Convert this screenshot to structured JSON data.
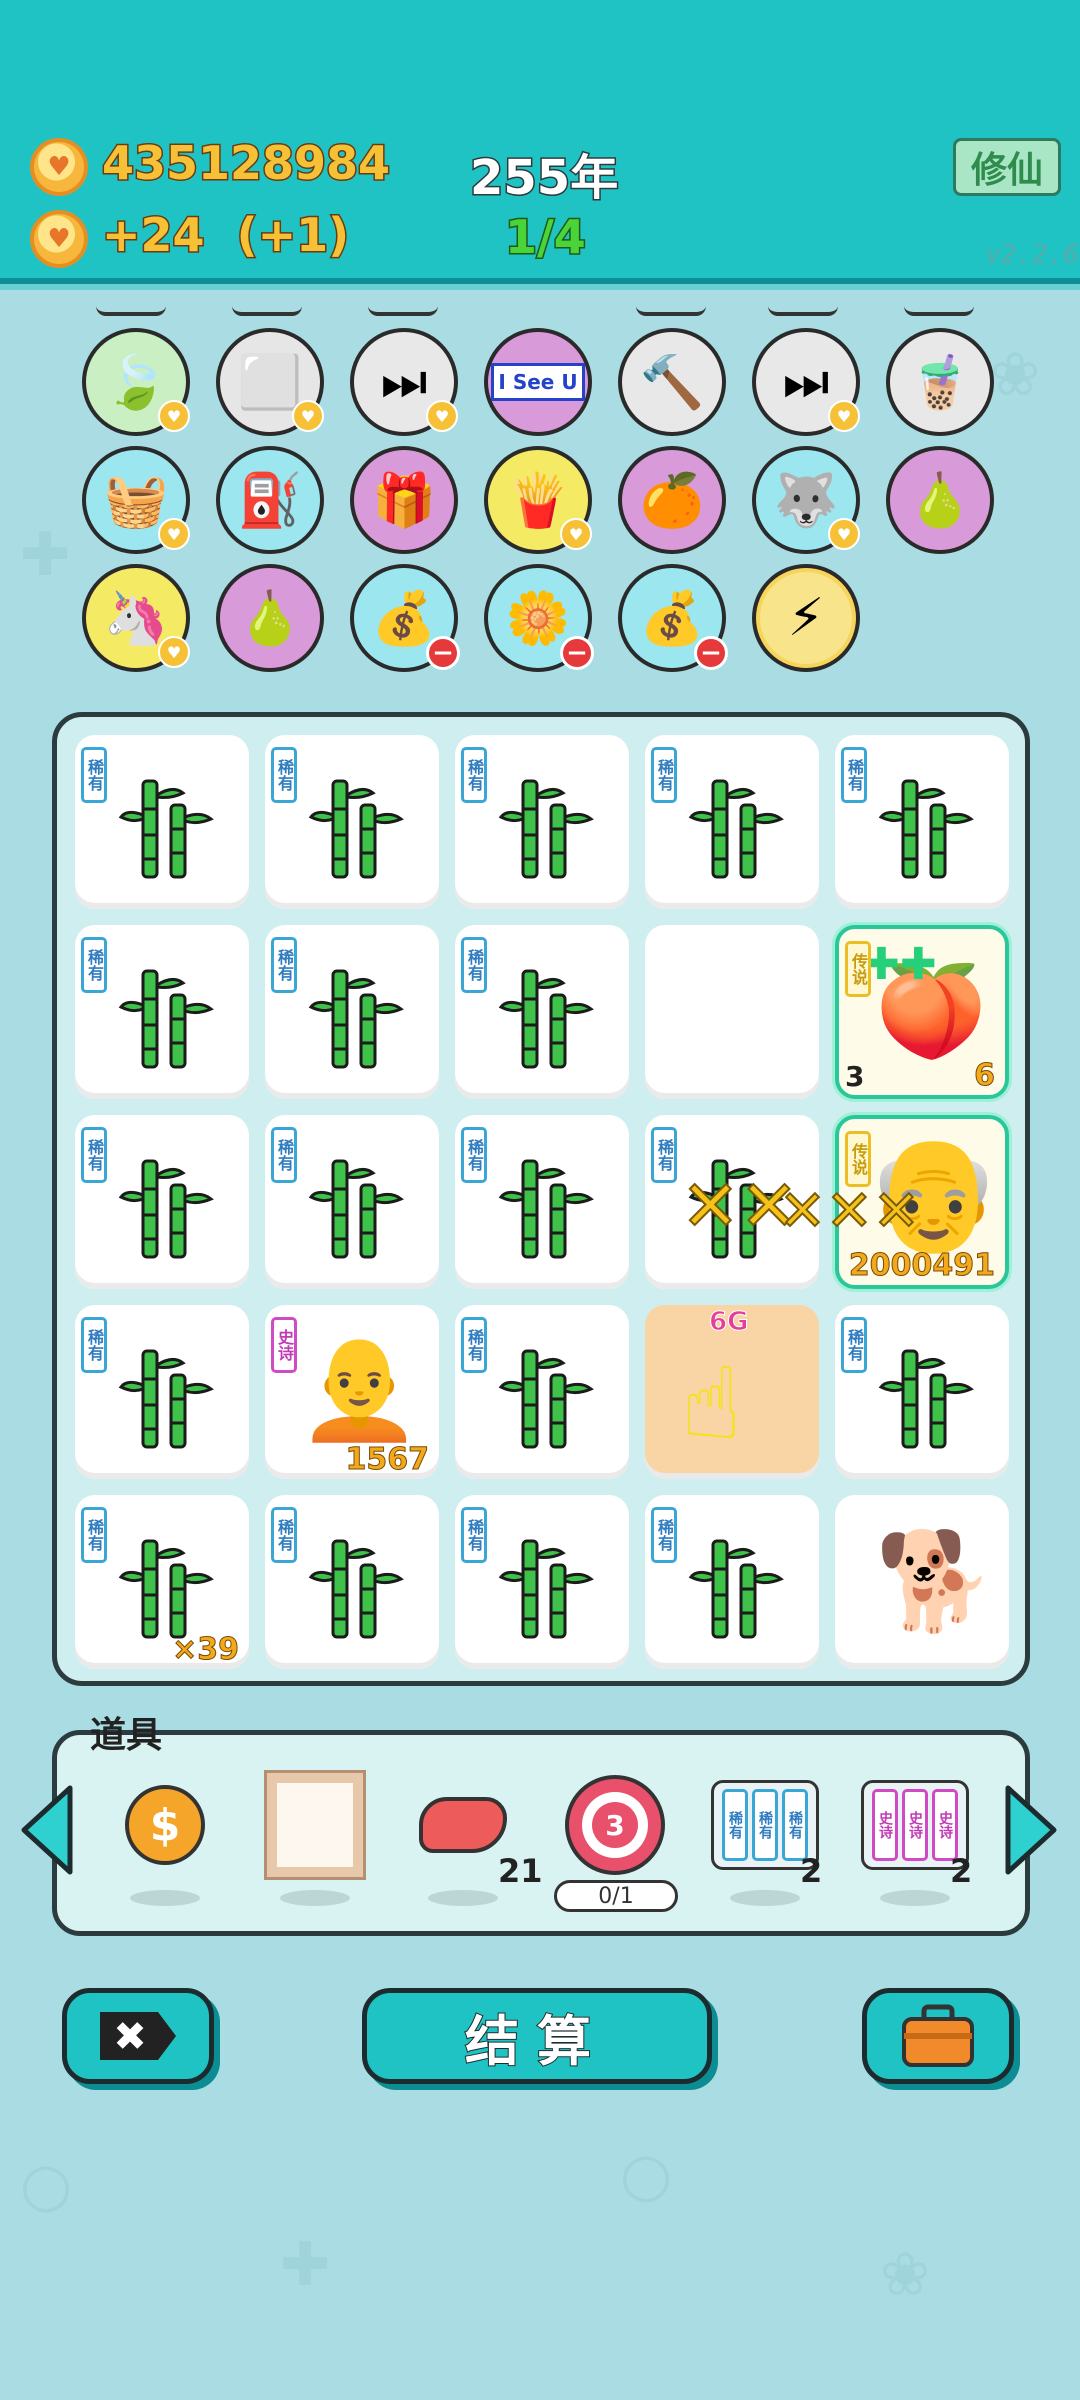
{
  "header": {
    "gold": "435128984",
    "income": "+24  (+1)",
    "year": "255年",
    "round": "1/4",
    "cultivate_label": "修仙",
    "version": "v2.2.6"
  },
  "relics": [
    {
      "name": "leaf",
      "icon": "🍃",
      "bg": "#c9efc3",
      "badge": "heart"
    },
    {
      "name": "sugar-cubes",
      "icon": "⬜",
      "bg": "#e6e6e6",
      "badge": "heart"
    },
    {
      "name": "skip",
      "icon": "⏭",
      "bg": "#e8e8e8",
      "badge": "heart"
    },
    {
      "name": "i-see-u",
      "icon": "I See U",
      "bg": "#d89ad8",
      "badge": "none"
    },
    {
      "name": "hammer",
      "icon": "🔨",
      "bg": "#e8e8e8",
      "badge": "none"
    },
    {
      "name": "skip-2",
      "icon": "⏭",
      "bg": "#e8e8e8",
      "badge": "heart"
    },
    {
      "name": "bubble-tea",
      "icon": "🧋",
      "bg": "#e8e8e8",
      "badge": "none"
    },
    {
      "name": "fruit-basket",
      "icon": "🧺",
      "bg": "#9be6ef",
      "badge": "heart"
    },
    {
      "name": "pump",
      "icon": "⛽",
      "bg": "#9be6ef",
      "badge": "none"
    },
    {
      "name": "pink-box",
      "icon": "🎁",
      "bg": "#d89ad8",
      "badge": "none"
    },
    {
      "name": "fries",
      "icon": "🍟",
      "bg": "#f4ea63",
      "badge": "heart"
    },
    {
      "name": "eyepatch-fruit",
      "icon": "🍊",
      "bg": "#d89ad8",
      "badge": "none"
    },
    {
      "name": "husky",
      "icon": "🐺",
      "bg": "#9be6ef",
      "badge": "heart"
    },
    {
      "name": "grapefruit",
      "icon": "🍐",
      "bg": "#d89ad8",
      "badge": "none"
    },
    {
      "name": "unicorn",
      "icon": "🦄",
      "bg": "#f4ea63",
      "badge": "heart"
    },
    {
      "name": "grapefruit-2",
      "icon": "🍐",
      "bg": "#d89ad8",
      "badge": "none"
    },
    {
      "name": "sack",
      "icon": "💰",
      "bg": "#9be6ef",
      "badge": "minus"
    },
    {
      "name": "flower-pot",
      "icon": "🌼",
      "bg": "#9be6ef",
      "badge": "minus"
    },
    {
      "name": "sack-2",
      "icon": "💰",
      "bg": "#9be6ef",
      "badge": "minus"
    },
    {
      "name": "lightning",
      "icon": "⚡",
      "bg": "#f8e48a",
      "badge": "none"
    }
  ],
  "tags": {
    "rare": "稀有",
    "epic": "史诗",
    "legend": "传说"
  },
  "board": {
    "cells": [
      {
        "type": "bamboo",
        "tag": "rare"
      },
      {
        "type": "bamboo",
        "tag": "rare"
      },
      {
        "type": "bamboo",
        "tag": "rare"
      },
      {
        "type": "bamboo",
        "tag": "rare"
      },
      {
        "type": "bamboo",
        "tag": "rare"
      },
      {
        "type": "bamboo",
        "tag": "rare"
      },
      {
        "type": "bamboo",
        "tag": "rare"
      },
      {
        "type": "bamboo",
        "tag": "rare"
      },
      {
        "type": "empty"
      },
      {
        "type": "fruit",
        "tag": "legend",
        "left": "3",
        "right": "6"
      },
      {
        "type": "bamboo",
        "tag": "rare"
      },
      {
        "type": "bamboo",
        "tag": "rare"
      },
      {
        "type": "bamboo",
        "tag": "rare"
      },
      {
        "type": "bamboo-hit",
        "tag": "rare"
      },
      {
        "type": "oldman",
        "tag": "legend",
        "right": "2000491"
      },
      {
        "type": "bamboo",
        "tag": "rare"
      },
      {
        "type": "glasses-man",
        "tag": "epic",
        "right": "1567"
      },
      {
        "type": "bamboo",
        "tag": "rare"
      },
      {
        "type": "hand",
        "top": "6G"
      },
      {
        "type": "bamboo",
        "tag": "rare"
      },
      {
        "type": "bamboo",
        "tag": "rare",
        "right": "×39"
      },
      {
        "type": "bamboo",
        "tag": "rare"
      },
      {
        "type": "bamboo",
        "tag": "rare"
      },
      {
        "type": "bamboo",
        "tag": "rare"
      },
      {
        "type": "dog"
      }
    ]
  },
  "tools": {
    "label": "道具",
    "items": [
      {
        "name": "coin-tool",
        "icon": "$",
        "count": ""
      },
      {
        "name": "frame-tool",
        "icon": "",
        "count": ""
      },
      {
        "name": "liver-tool",
        "icon": "🫀",
        "count": "21"
      },
      {
        "name": "target-tool",
        "icon": "3",
        "count": "",
        "progress": "0/1"
      },
      {
        "name": "rare-pack",
        "icon": "稀有",
        "count": "2"
      },
      {
        "name": "epic-pack",
        "icon": "史诗",
        "count": "2"
      }
    ]
  },
  "buttons": {
    "skip_icon": "✖",
    "settle_label": "结算",
    "bag_icon": "💼"
  }
}
